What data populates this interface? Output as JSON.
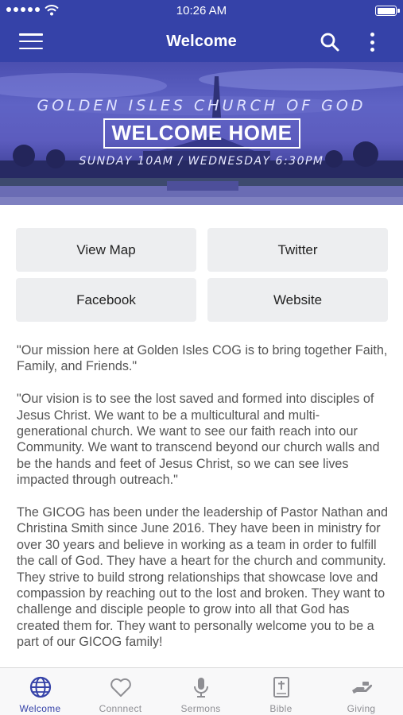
{
  "status_bar": {
    "time": "10:26 AM"
  },
  "nav": {
    "title": "Welcome"
  },
  "hero": {
    "church_name": "GOLDEN ISLES CHURCH OF GOD",
    "headline": "WELCOME HOME",
    "service_times": "SUNDAY 10AM / WEDNESDAY 6:30PM"
  },
  "buttons": [
    "View Map",
    "Twitter",
    "Facebook",
    "Website"
  ],
  "content": {
    "paragraphs": [
      "\"Our mission here at Golden Isles COG is to bring together Faith, Family, and Friends.\"",
      "\"Our vision is to see the lost saved and formed into disciples of Jesus Christ.  We want to be a multicultural and multi-generational church. We want to see our faith reach into our Community.  We want to transcend beyond our church walls and be the hands and feet of Jesus Christ, so we can see lives impacted through outreach.\"",
      "The GICOG has been under the leadership of Pastor Nathan and Christina Smith since June 2016.  They have been in ministry for over 30 years and believe in working as a team in order to fulfill the call of God. They have a heart for the church and community.  They strive to build strong relationships that showcase love and compassion by reaching out to the lost and broken.  They want to challenge and disciple people to grow into all that God has created them for. They want to personally welcome you to be a part of our GICOG family!"
    ]
  },
  "tabs": [
    {
      "label": "Welcome",
      "icon": "globe-icon",
      "active": true
    },
    {
      "label": "Connnect",
      "icon": "heart-icon",
      "active": false
    },
    {
      "label": "Sermons",
      "icon": "microphone-icon",
      "active": false
    },
    {
      "label": "Bible",
      "icon": "bible-icon",
      "active": false
    },
    {
      "label": "Giving",
      "icon": "giving-hand-icon",
      "active": false
    }
  ],
  "colors": {
    "brand": "#3542a8",
    "inactive": "#8e8e93",
    "button_bg": "#edeef0",
    "body_text": "#555555"
  }
}
